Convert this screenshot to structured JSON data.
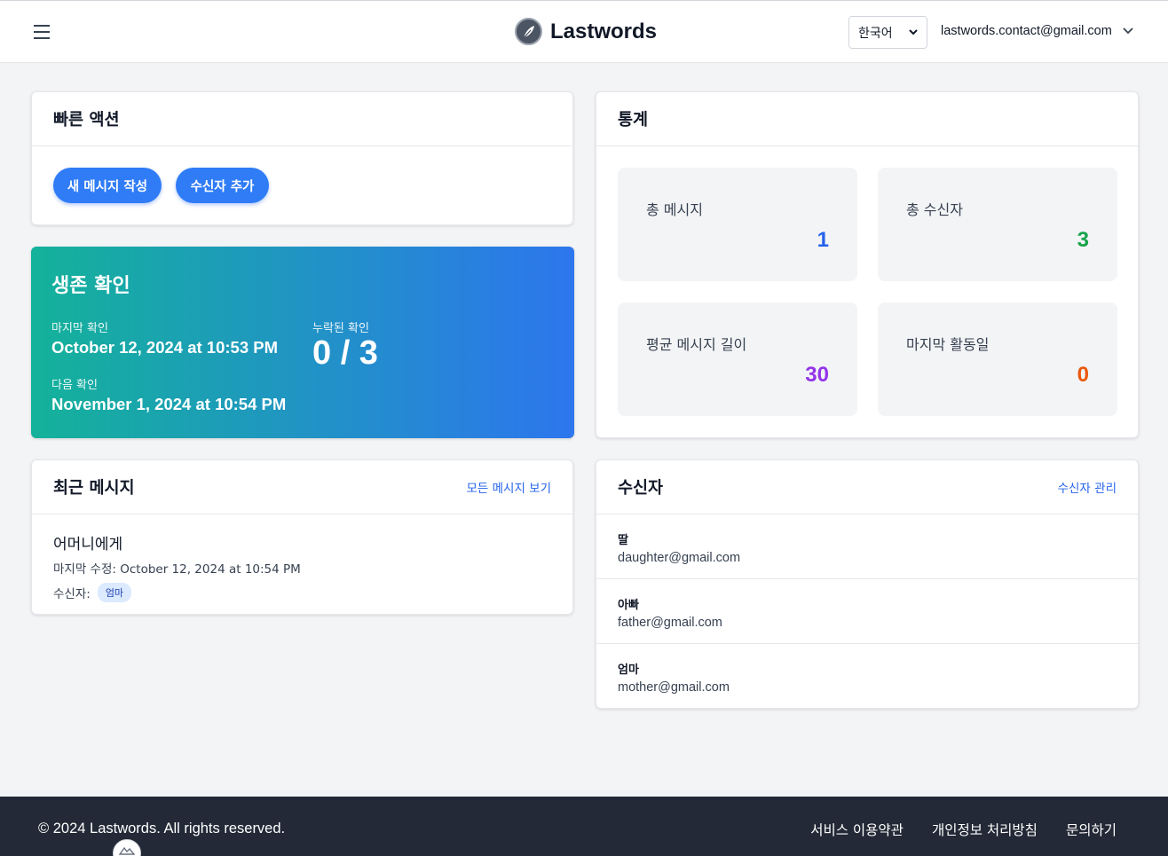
{
  "header": {
    "brand": "Lastwords",
    "language": "한국어",
    "user_email": "lastwords.contact@gmail.com"
  },
  "quick_actions": {
    "title": "빠른 액션",
    "new_message": "새 메시지 작성",
    "add_recipient": "수신자 추가"
  },
  "alive_check": {
    "title": "생존 확인",
    "last_label": "마지막 확인",
    "last_value": "October 12, 2024 at 10:53 PM",
    "next_label": "다음 확인",
    "next_value": "November 1, 2024 at 10:54 PM",
    "missed_label": "누락된 확인",
    "missed_value": "0 / 3"
  },
  "stats": {
    "title": "통계",
    "items": [
      {
        "label": "총 메시지",
        "value": "1",
        "color": "#2563eb"
      },
      {
        "label": "총 수신자",
        "value": "3",
        "color": "#16a34a"
      },
      {
        "label": "평균 메시지 길이",
        "value": "30",
        "color": "#9333ea"
      },
      {
        "label": "마지막 활동일",
        "value": "0",
        "color": "#ea580c"
      }
    ]
  },
  "recent": {
    "title": "최근 메시지",
    "view_all": "모든 메시지 보기",
    "message": {
      "title": "어머니에게",
      "modified": "마지막 수정: October 12, 2024 at 10:54 PM",
      "recipient_label": "수신자:",
      "recipient_tag": "엄마"
    }
  },
  "recipients": {
    "title": "수신자",
    "manage": "수신자 관리",
    "items": [
      {
        "name": "딸",
        "email": "daughter@gmail.com"
      },
      {
        "name": "아빠",
        "email": "father@gmail.com"
      },
      {
        "name": "엄마",
        "email": "mother@gmail.com"
      }
    ]
  },
  "footer": {
    "copyright": "© 2024 Lastwords. All rights reserved.",
    "links": [
      "서비스 이용약관",
      "개인정보 처리방침",
      "문의하기"
    ]
  }
}
